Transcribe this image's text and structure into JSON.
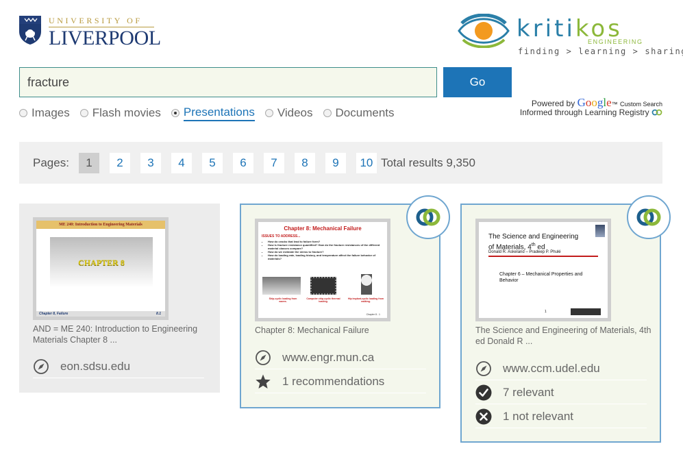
{
  "header": {
    "university_top": "UNIVERSITY OF",
    "university_main": "LIVERPOOL",
    "kritikos_name": "kritikos",
    "kritikos_sub": "ENGINEERING",
    "kritikos_tagline": "finding > learning > sharing"
  },
  "search": {
    "query": "fracture",
    "go_label": "Go"
  },
  "powered": {
    "prefix": "Powered by",
    "google": "Google",
    "tm": "™",
    "custom": "Custom Search",
    "informed": "Informed through Learning Registry"
  },
  "media_types": [
    {
      "label": "Images",
      "selected": false
    },
    {
      "label": "Flash movies",
      "selected": false
    },
    {
      "label": "Presentations",
      "selected": true
    },
    {
      "label": "Videos",
      "selected": false
    },
    {
      "label": "Documents",
      "selected": false
    }
  ],
  "pagination": {
    "label": "Pages:",
    "pages": [
      "1",
      "2",
      "3",
      "4",
      "5",
      "6",
      "7",
      "8",
      "9",
      "10"
    ],
    "current": "1",
    "total": "Total results 9,350"
  },
  "results": [
    {
      "title": "AND = ME 240: Introduction to Engineering Materials Chapter 8 ...",
      "site": "eon.sdsu.edu",
      "thumb": {
        "heading": "ME 240: Introduction to Engineering Materials",
        "center": "CHAPTER 8",
        "footer_left": "Chapter 8, Failure",
        "footer_right": "8.1"
      }
    },
    {
      "title": "Chapter 8: Mechanical Failure",
      "site": "www.engr.mun.ca",
      "recommendations": "1 recommendations",
      "thumb": {
        "heading": "Chapter 8: Mechanical Failure",
        "sub": "ISSUES TO ADDRESS...",
        "bullets": [
          "How do cracks that lead to failure form?",
          "How is fracture resistance quantified? How do the fracture resistances of the different material classes compare?",
          "How do we estimate the stress to fracture?",
          "How do loading rate, loading history, and temperature affect the failure behavior of materials?"
        ],
        "captions": [
          "Ship-cyclic loading from waves.",
          "Computer chip-cyclic thermal loading.",
          "Hip implant-cyclic loading from walking."
        ],
        "page_label": "Chapter 8 - 1"
      }
    },
    {
      "title": "The Science and Engineering of Materials, 4th ed Donald R ...",
      "site": "www.ccm.udel.edu",
      "relevant": "7 relevant",
      "not_relevant": "1 not relevant",
      "thumb": {
        "heading_a": "The Science and Engineering",
        "heading_b": "of Materials, 4",
        "heading_sup": "th",
        "heading_c": " ed",
        "authors": "Donald R. Askeland – Pradeep P. Phulé",
        "chapter": "Chapter 6 – Mechanical Properties and Behavior",
        "page": "1"
      }
    }
  ],
  "colors": {
    "accent": "#1d74b7",
    "card_border": "#6fa6d0",
    "kritikos_blue": "#2a7fa8",
    "kritikos_green": "#8cb83a",
    "liverpool_navy": "#1e3a72",
    "liverpool_gold": "#b89a3e"
  },
  "icons": {
    "site": "compass-icon",
    "recommendations": "star-icon",
    "relevant": "checkmark-circle-icon",
    "not_relevant": "x-circle-icon",
    "badge": "learning-registry-icon"
  }
}
